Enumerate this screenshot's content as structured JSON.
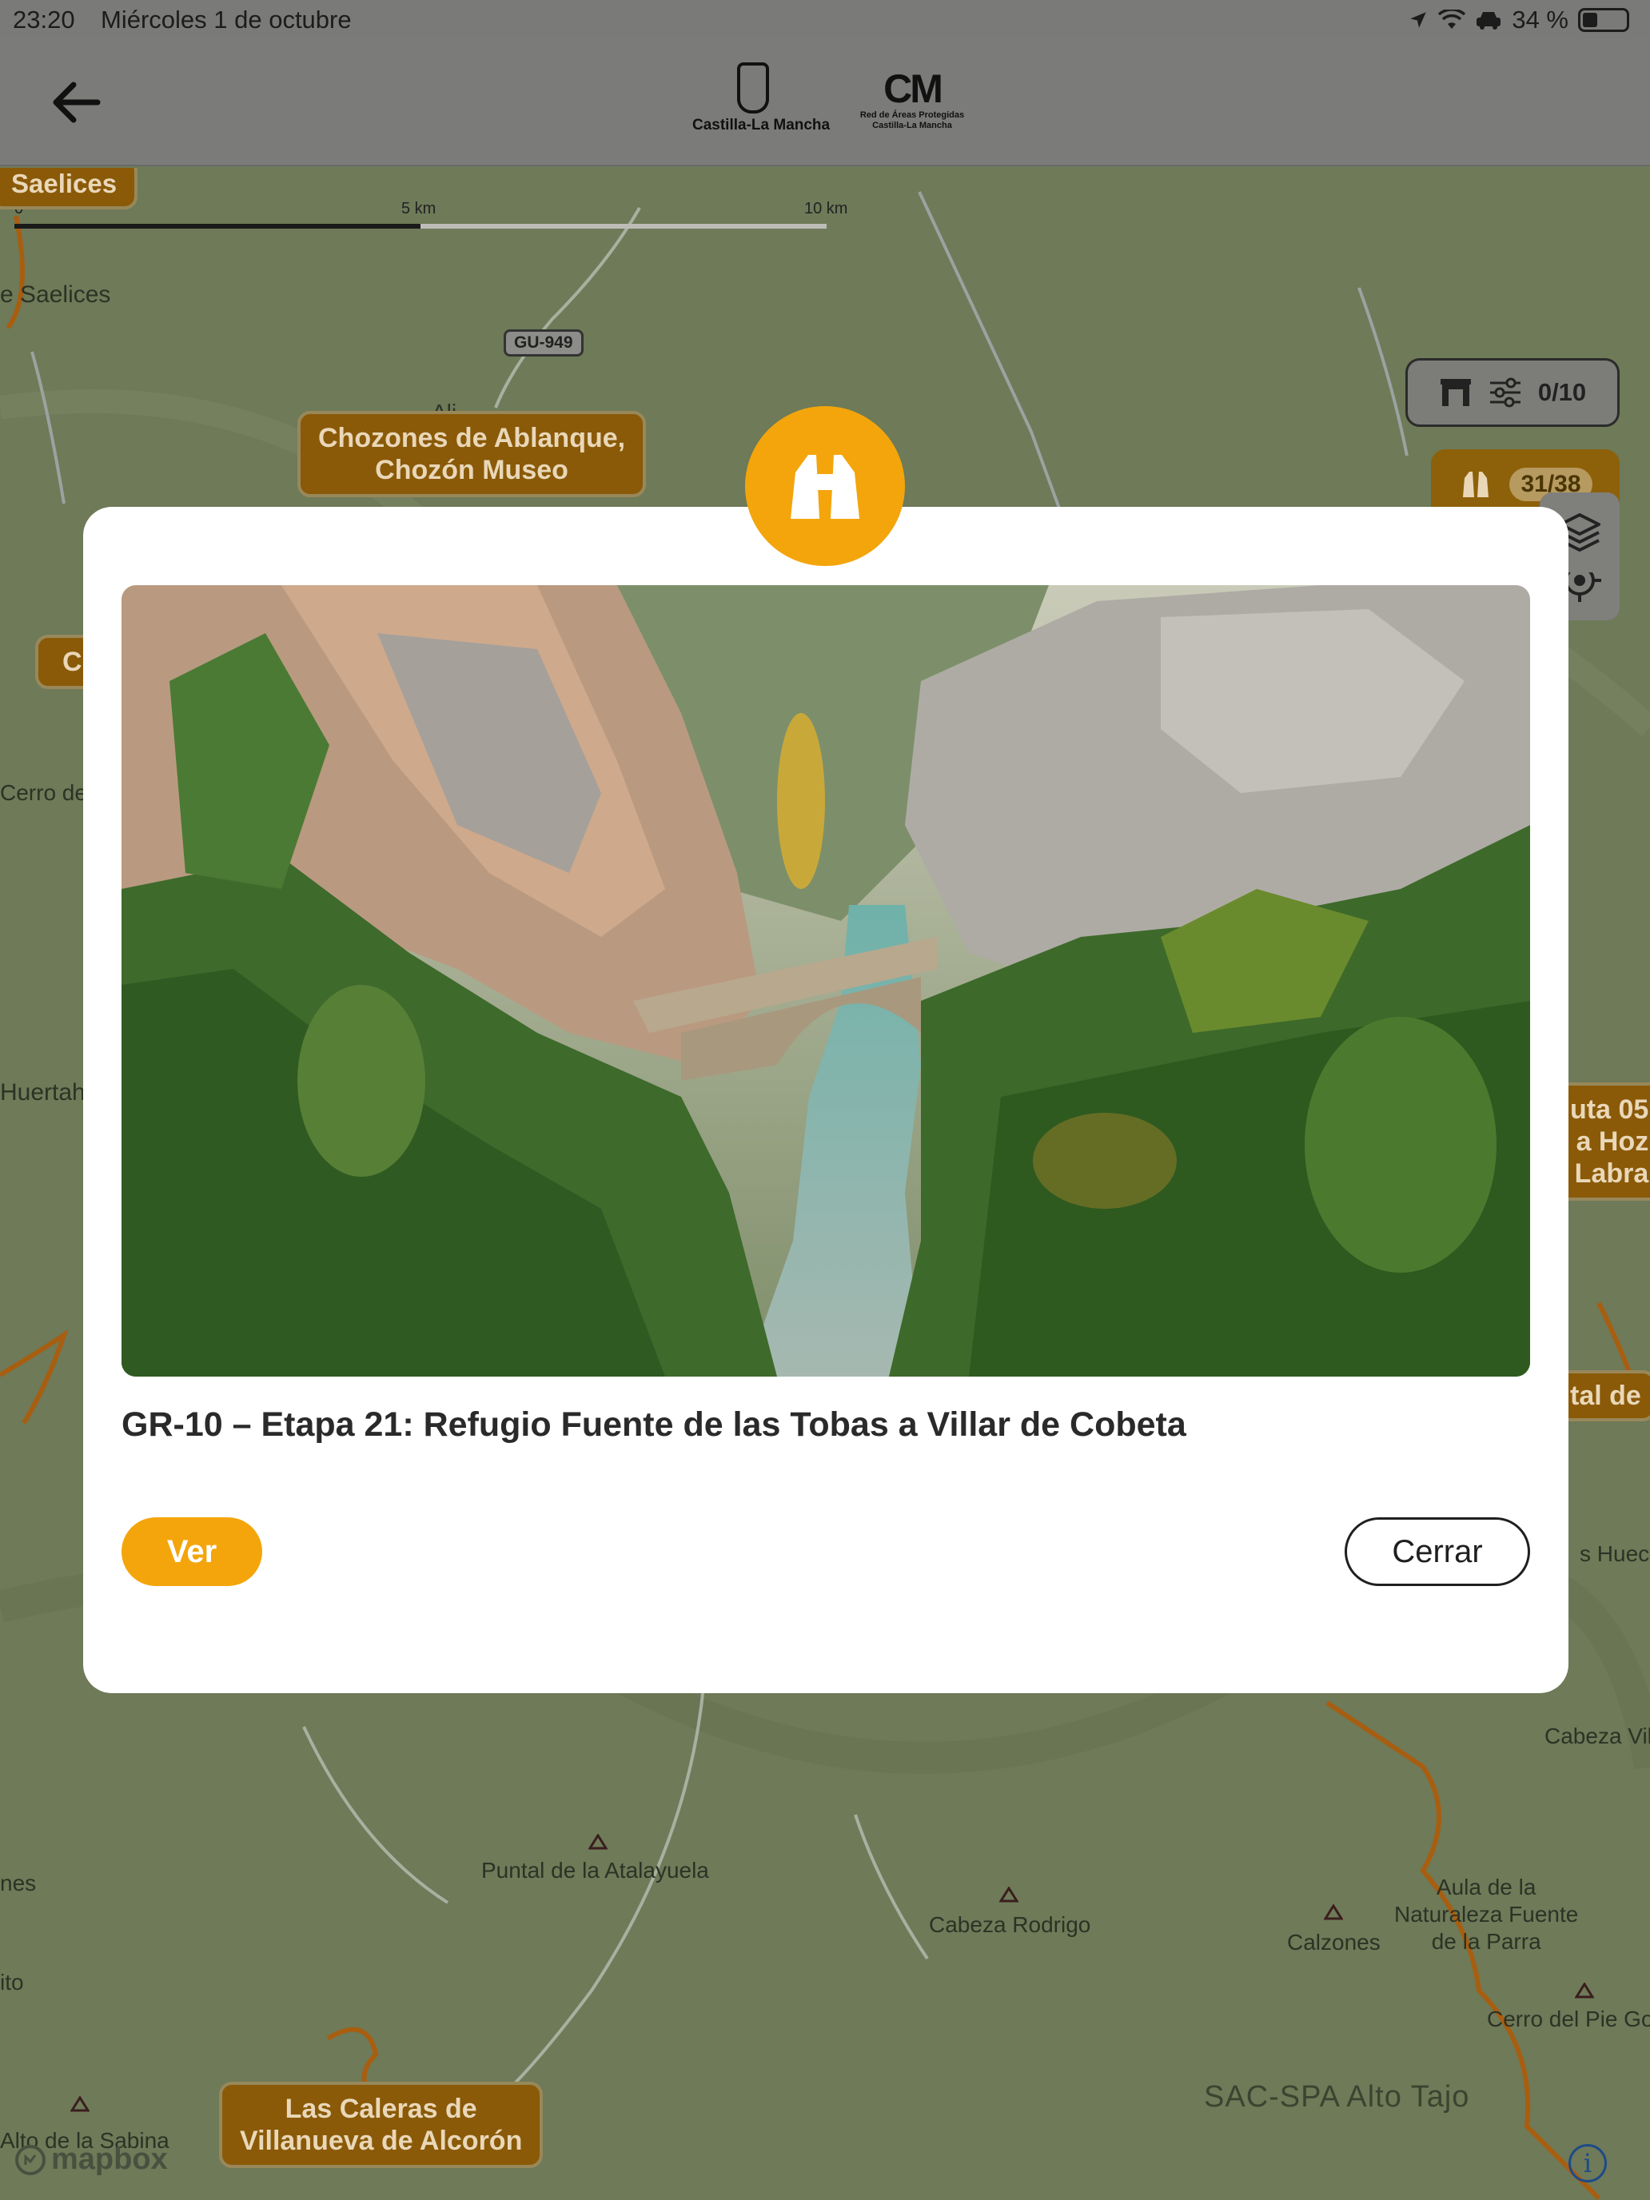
{
  "status_bar": {
    "time": "23:20",
    "date": "Miércoles 1 de octubre",
    "battery_text": "34 %",
    "battery_level": 0.34
  },
  "header": {
    "logo1_text": "Castilla-La Mancha",
    "logo2_mark": "CM",
    "logo2_line1": "Red de Áreas Protegidas",
    "logo2_line2": "Castilla-La Mancha"
  },
  "map": {
    "scale": {
      "start": "0",
      "mid": "5 km",
      "end": "10 km"
    },
    "road_label": "GU-949",
    "labels": {
      "saelices_place": "e Saelices",
      "cerro": "Cerro de",
      "huertah": "Huertah",
      "huecos": "s Huecos",
      "cabeza_vil": "Cabeza Vil",
      "nes": "nes",
      "ito": "ito",
      "puntal": "Puntal de la Atalayuela",
      "cabeza_rodrigo": "Cabeza Rodrigo",
      "calzones": "Calzones",
      "aula": "Aula de la\nNaturaleza Fuente\nde la Parra",
      "cerro_pie": "Cerro del Pie Go",
      "sabina": "Alto de la Sabina",
      "sac_spa": "SAC-SPA Alto Tajo",
      "mapbox": "mapbox",
      "ali": "Ali"
    },
    "badges": {
      "saelices": "Saelices",
      "chozones": "Chozones de Ablanque,\nChozón Museo",
      "c_left": "C",
      "ruta_right": "uta 05\na Hoz\nLabra",
      "tal_right": "tal de",
      "caleras": "Las Caleras de\nVillanueva de Alcorón"
    },
    "filter_count": "0/10",
    "viewpoint_count": "31/38"
  },
  "modal": {
    "title": "GR-10 – Etapa 21: Refugio Fuente de las Tobas a Villar de Cobeta",
    "ver_label": "Ver",
    "cerrar_label": "Cerrar"
  },
  "colors": {
    "accent": "#f3a50b",
    "badge_brown": "#8a5a08",
    "map_bg": "#6e7a58"
  }
}
